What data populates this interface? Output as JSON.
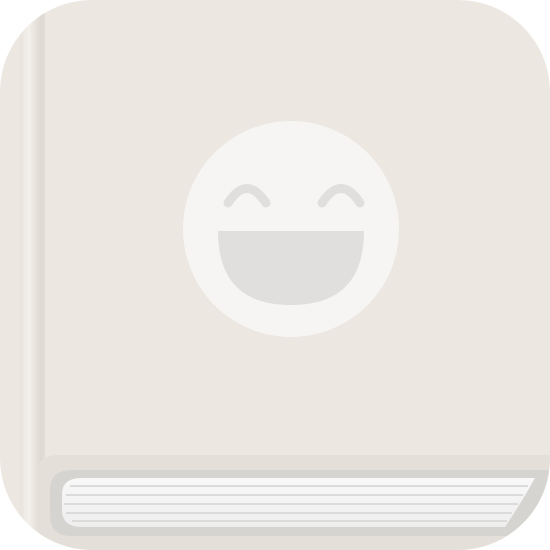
{
  "app_icon": {
    "icon_name": "book-with-smiley-face-icon",
    "colors": {
      "cover": "#ECE7E0",
      "spine": "#E2DDD5",
      "spine_highlight": "#F3F0EB",
      "bottom_edge": "#E4DFD8",
      "page_block": "#D4D2CF",
      "pages": "#F4F4F4",
      "page_lines": "#DDDCDA",
      "face": "#F6F5F3",
      "face_features": "#E0DFDD"
    }
  }
}
